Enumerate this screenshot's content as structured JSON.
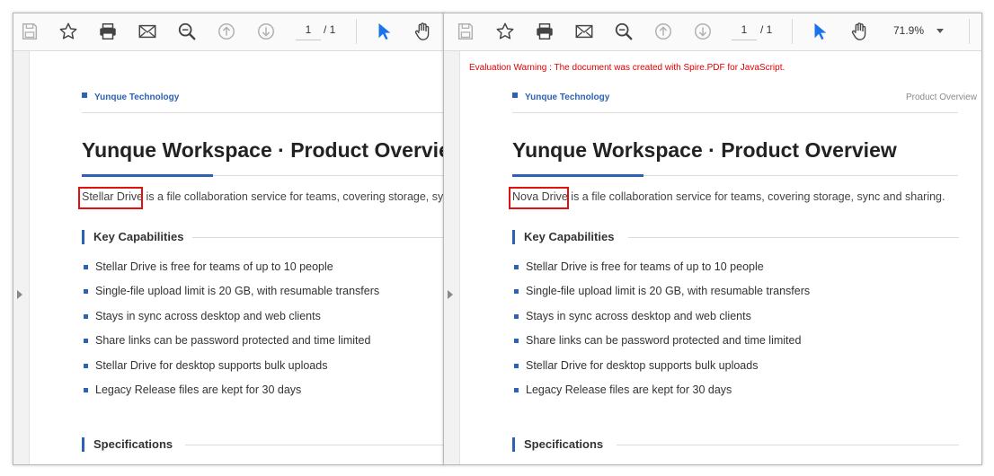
{
  "left": {
    "toolbar": {
      "page_current": "1",
      "page_total": "/ 1"
    },
    "brand": "Yunque Technology",
    "title": "Yunque Workspace · Product Overview",
    "intro": {
      "highlighted": "Stellar Drive",
      "rest": " is a file collaboration service for teams, covering storage, sync and sharing."
    },
    "section1": "Key Capabilities",
    "bullets": [
      "Stellar Drive is free for teams of up to 10 people",
      "Single-file upload limit is 20 GB, with resumable transfers",
      "Stays in sync across desktop and web clients",
      "Share links can be password protected and time limited",
      "Stellar Drive for desktop supports bulk uploads",
      "Legacy Release files are kept for 30 days"
    ],
    "section2": "Specifications"
  },
  "right": {
    "toolbar": {
      "page_current": "1",
      "page_total": "/ 1",
      "zoom": "71.9%"
    },
    "warning": "Evaluation Warning : The document was created with Spire.PDF for JavaScript.",
    "brand": "Yunque Technology",
    "header_right": "Product Overview",
    "title": "Yunque Workspace · Product Overview",
    "intro": {
      "highlighted": "Nova Drive",
      "rest": " is a file collaboration service for teams, covering storage, sync and sharing."
    },
    "section1": "Key Capabilities",
    "bullets": [
      "Stellar Drive is free for teams of up to 10 people",
      "Single-file upload limit is 20 GB, with resumable transfers",
      "Stays in sync across desktop and web clients",
      "Share links can be password protected and time limited",
      "Stellar Drive for desktop supports bulk uploads",
      "Legacy Release files are kept for 30 days"
    ],
    "section2": "Specifications"
  },
  "icons": [
    "save-icon",
    "bookmark-star-icon",
    "print-icon",
    "email-icon",
    "search-zoom-icon",
    "previous-page-icon",
    "next-page-icon",
    "select-cursor-icon",
    "hand-pan-icon"
  ],
  "colors": {
    "accent": "#2c62b4",
    "highlight": "#e21010",
    "warning": "#e00000"
  }
}
